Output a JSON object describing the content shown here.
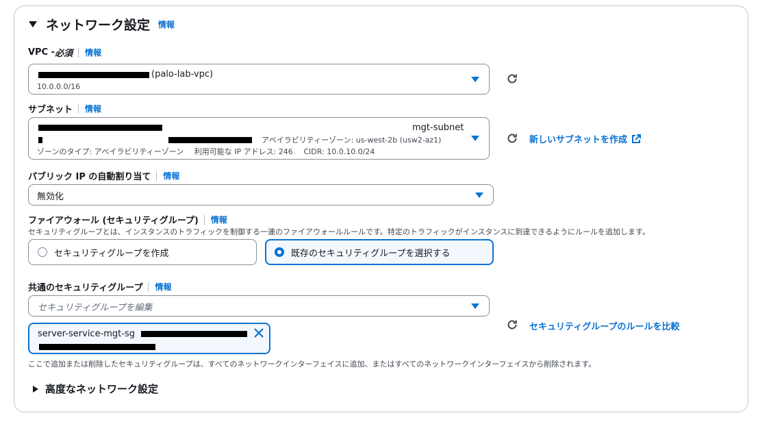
{
  "section": {
    "title": "ネットワーク設定",
    "info": "情報"
  },
  "vpc": {
    "label": "VPC - ",
    "label_required": "必須",
    "info": "情報",
    "selected_name": "(palo-lab-vpc)",
    "selected_cidr": "10.0.0.0/16"
  },
  "subnet": {
    "label": "サブネット",
    "info": "情報",
    "name": "mgt-subnet",
    "az": "アベイラビリティーゾーン: us-west-2b (usw2-az1)",
    "zone_type": "ゾーンのタイプ: アベイラビリティーゾーン",
    "available_ips": "利用可能な IP アドレス: 246",
    "cidr": "CIDR: 10.0.10.0/24",
    "create_link": "新しいサブネットを作成"
  },
  "public_ip": {
    "label": "パブリック IP の自動割り当て",
    "info": "情報",
    "value": "無効化"
  },
  "firewall": {
    "label": "ファイアウォール (セキュリティグループ)",
    "info": "情報",
    "description": "セキュリティグループとは、インスタンスのトラフィックを制御する一連のファイアウォールルールです。特定のトラフィックがインスタンスに到達できるようにルールを追加します。",
    "option_create": "セキュリティグループを作成",
    "option_existing": "既存のセキュリティグループを選択する"
  },
  "common_sg": {
    "label": "共通のセキュリティグループ",
    "info": "情報",
    "placeholder": "セキュリティグループを編集",
    "token_name": "server-service-mgt-sg",
    "compare_link": "セキュリティグループのルールを比較",
    "help": "ここで追加または削除したセキュリティグループは、すべてのネットワークインターフェイスに追加、またはすべてのネットワークインターフェイスから削除されます。"
  },
  "advanced": {
    "title": "高度なネットワーク設定"
  },
  "colors": {
    "accent": "#0972d3",
    "border": "#8c8c94",
    "text": "#16191f"
  }
}
